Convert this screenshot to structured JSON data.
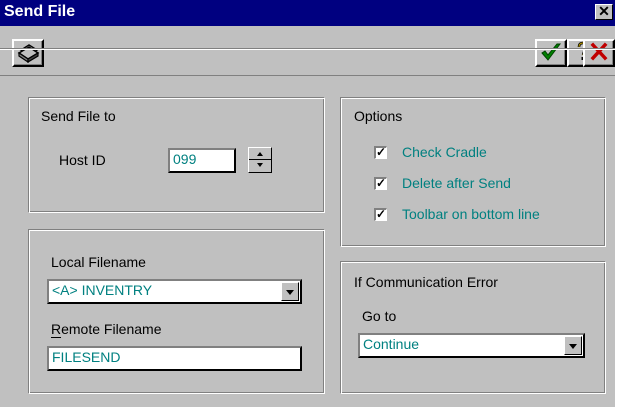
{
  "window": {
    "title": "Send File",
    "close_glyph": "✕"
  },
  "toolbar": {
    "print_icon": "printer-icon",
    "ok_icon": "checkmark-icon",
    "help_icon": "question-icon",
    "cancel_icon": "x-icon",
    "ok_color": "#008000",
    "cancel_color": "#c00000"
  },
  "send_to": {
    "title": "Send File to",
    "host_id_label": "Host ID",
    "host_id_value": "099"
  },
  "options": {
    "title": "Options",
    "items": [
      {
        "label": "Check Cradle",
        "checked": true
      },
      {
        "label": "Delete after Send",
        "checked": true
      },
      {
        "label": "Toolbar on bottom line",
        "checked": true
      }
    ]
  },
  "files": {
    "local_label": "Local Filename",
    "local_value": "<A> INVENTRY",
    "remote_label": "Remote Filename",
    "remote_value": "FILESEND"
  },
  "comm_error": {
    "title": "If Communication Error",
    "goto_label": "Go to",
    "goto_value": "Continue"
  },
  "colors": {
    "accent": "#008080",
    "titlebar": "#000080",
    "face": "#c0c0c0"
  }
}
